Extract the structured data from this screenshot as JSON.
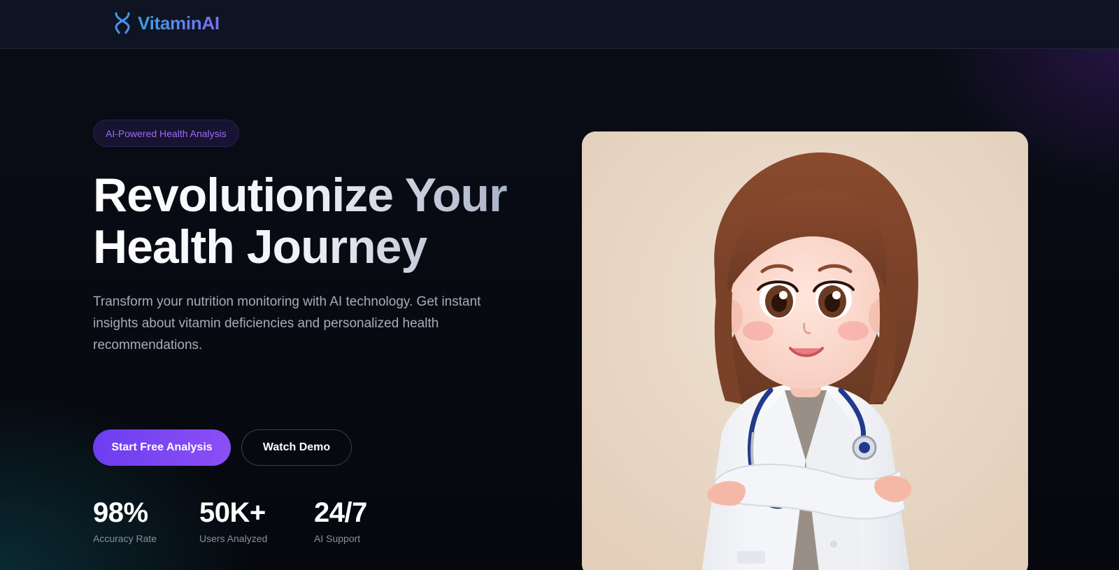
{
  "navbar": {
    "brand_name": "VitaminAI",
    "brand_icon": "dna-icon",
    "brand_gradient": [
      "#3aa0e8",
      "#7b6cf0"
    ]
  },
  "hero": {
    "badge": "AI-Powered Health Analysis",
    "headline_line1": "Revolutionize Your",
    "headline_line2": "Health Journey",
    "subtext": "Transform your nutrition monitoring with AI technology. Get instant insights about vitamin deficiencies and personalized health recommendations.",
    "primary_button": "Start Free Analysis",
    "secondary_button": "Watch Demo",
    "stats": [
      {
        "value": "98%",
        "label": "Accuracy Rate"
      },
      {
        "value": "50K+",
        "label": "Users Analyzed"
      },
      {
        "value": "24/7",
        "label": "AI Support"
      }
    ],
    "illustration_icon": "doctor-avatar-illustration"
  },
  "colors": {
    "accent": "#7c45f2",
    "background": "#05070d",
    "navbar": "#0e1421",
    "badge_text": "#9a6df4"
  }
}
